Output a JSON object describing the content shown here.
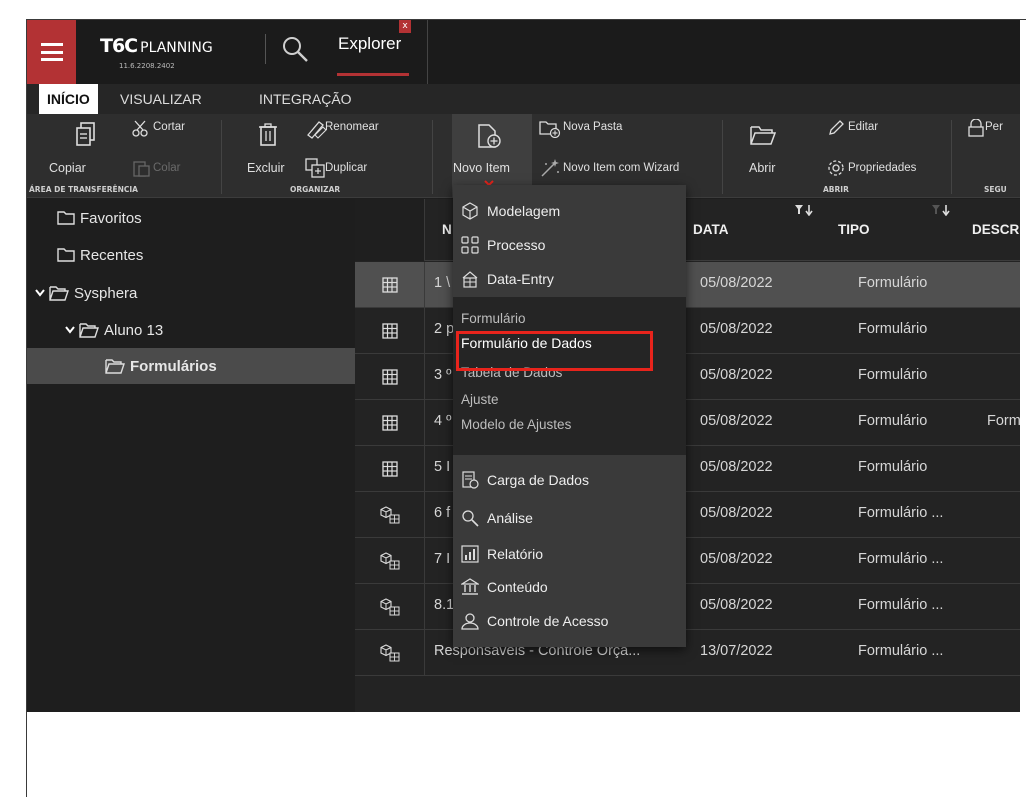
{
  "app": {
    "brand_mark": "T6C",
    "brand_word": "PLANNING",
    "version": "11.6.2208.2402",
    "explorer_tab": "Explorer",
    "close_glyph": "x"
  },
  "menubar": {
    "tabs": [
      "INÍCIO",
      "VISUALIZAR",
      "INTEGRAÇÃO"
    ]
  },
  "ribbon": {
    "copiar": "Copiar",
    "cortar": "Cortar",
    "colar": "Colar",
    "excluir": "Excluir",
    "renomear": "Renomear",
    "duplicar": "Duplicar",
    "novo_item": "Novo Item",
    "nova_pasta": "Nova Pasta",
    "novo_item_wizard": "Novo Item com Wizard",
    "abrir": "Abrir",
    "editar": "Editar",
    "propriedades": "Propriedades",
    "per": "Per",
    "groups": {
      "area": "ÁREA DE TRANSFERÊNCIA",
      "organizar": "ORGANIZAR",
      "abrir": "ABRIR",
      "segu": "SEGU"
    }
  },
  "sidebar": {
    "items": [
      {
        "label": "Favoritos"
      },
      {
        "label": "Recentes"
      },
      {
        "label": "Sysphera"
      },
      {
        "label": "Aluno 13"
      },
      {
        "label": "Formulários"
      }
    ]
  },
  "table": {
    "headers": {
      "nome": "N",
      "data": "DATA",
      "tipo": "TIPO",
      "desc": "DESCR"
    },
    "rows": [
      {
        "name": "1 \\",
        "date": "05/08/2022",
        "type": "Formulário",
        "desc": "",
        "icon": "grid-icon"
      },
      {
        "name": "2 p",
        "date": "05/08/2022",
        "type": "Formulário",
        "desc": "",
        "icon": "grid-icon"
      },
      {
        "name": "3 º",
        "date": "05/08/2022",
        "type": "Formulário",
        "desc": "",
        "icon": "grid-icon"
      },
      {
        "name": "4 º",
        "date": "05/08/2022",
        "type": "Formulário",
        "desc": "Formu",
        "icon": "grid-icon"
      },
      {
        "name": "5 I",
        "date": "05/08/2022",
        "type": "Formulário",
        "desc": "",
        "icon": "grid-icon"
      },
      {
        "name": "6 f",
        "date": "05/08/2022",
        "type": "Formulário ...",
        "desc": "",
        "icon": "cube-grid-icon"
      },
      {
        "name": "7 I",
        "date": "05/08/2022",
        "type": "Formulário ...",
        "desc": "",
        "icon": "cube-grid-icon"
      },
      {
        "name": "8.1",
        "date": "05/08/2022",
        "type": "Formulário ...",
        "desc": "",
        "icon": "cube-grid-icon"
      },
      {
        "name": "Responsáveis - Controle Orça...",
        "date": "13/07/2022",
        "type": "Formulário ...",
        "desc": "",
        "icon": "cube-grid-icon"
      }
    ]
  },
  "dropdown": {
    "modelagem": "Modelagem",
    "processo": "Processo",
    "data_entry": "Data-Entry",
    "sub": {
      "formulario": "Formulário",
      "formulario_dados": "Formulário de Dados",
      "tabela_dados": "Tabela de Dados",
      "ajuste": "Ajuste",
      "modelo_ajustes": "Modelo de Ajustes"
    },
    "carga": "Carga de Dados",
    "analise": "Análise",
    "relatorio": "Relatório",
    "conteudo": "Conteúdo",
    "controle": "Controle de Acesso"
  },
  "colors": {
    "brand_red": "#b33234",
    "highlight_red": "#e8241c",
    "background": "#1e1e1e"
  }
}
